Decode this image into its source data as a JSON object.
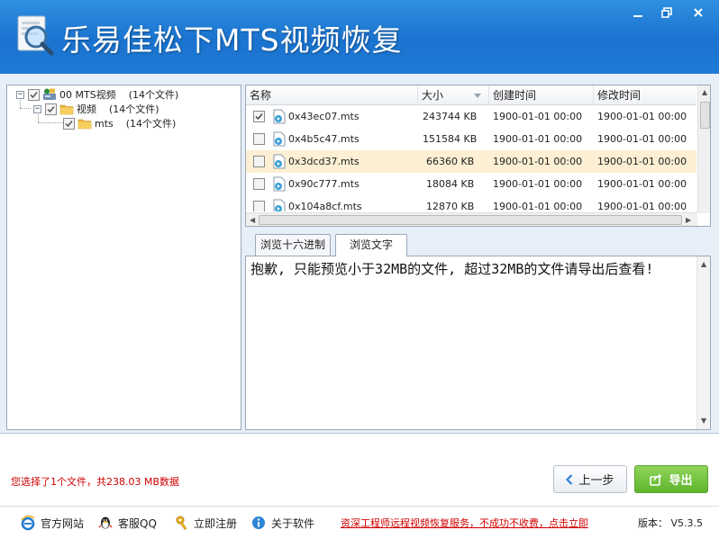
{
  "window": {
    "title": "乐易佳松下MTS视频恢复",
    "min_glyph": "—",
    "max_glyph": "□",
    "close_glyph": "✕"
  },
  "tree": {
    "items": [
      {
        "name": "00  MTS视频",
        "count": "(14个文件)",
        "expander": "−"
      },
      {
        "name": "视频",
        "count": "(14个文件)",
        "expander": "−"
      },
      {
        "name": "mts",
        "count": "(14个文件)"
      }
    ]
  },
  "file_list": {
    "columns": [
      "名称",
      "大小",
      "创建时间",
      "修改时间"
    ],
    "rows": [
      {
        "name": "0x43ec07.mts",
        "size": "243744 KB",
        "created": "1900-01-01  00:00",
        "modified": "1900-01-01  00:00",
        "checked": true
      },
      {
        "name": "0x4b5c47.mts",
        "size": "151584 KB",
        "created": "1900-01-01  00:00",
        "modified": "1900-01-01  00:00",
        "checked": false
      },
      {
        "name": "0x3dcd37.mts",
        "size": "66360 KB",
        "created": "1900-01-01  00:00",
        "modified": "1900-01-01  00:00",
        "checked": false
      },
      {
        "name": "0x90c777.mts",
        "size": "18084 KB",
        "created": "1900-01-01  00:00",
        "modified": "1900-01-01  00:00",
        "checked": false
      },
      {
        "name": "0x104a8cf.mts",
        "size": "12870 KB",
        "created": "1900-01-01  00:00",
        "modified": "1900-01-01  00:00",
        "checked": false
      }
    ]
  },
  "tabs": [
    "浏览十六进制",
    "浏览文字"
  ],
  "preview": {
    "text": "抱歉, 只能预览小于32MB的文件, 超过32MB的文件请导出后查看!"
  },
  "status": {
    "text": "您选择了1个文件，共238.03 MB数据"
  },
  "buttons": {
    "prev": "上一步",
    "export": "导出"
  },
  "footer": {
    "website": "官方网站",
    "qq": "客服QQ",
    "register": "立即注册",
    "about": "关于软件",
    "promo": "资深工程师远程视频恢复服务，不成功不收费，点击立即",
    "version": "版本： V5.3.5"
  },
  "colors": {
    "title_bar": "#1a73cf",
    "selected_row": "#fcefd3",
    "export_green": "#5fb52c",
    "status_red": "#d00000"
  }
}
